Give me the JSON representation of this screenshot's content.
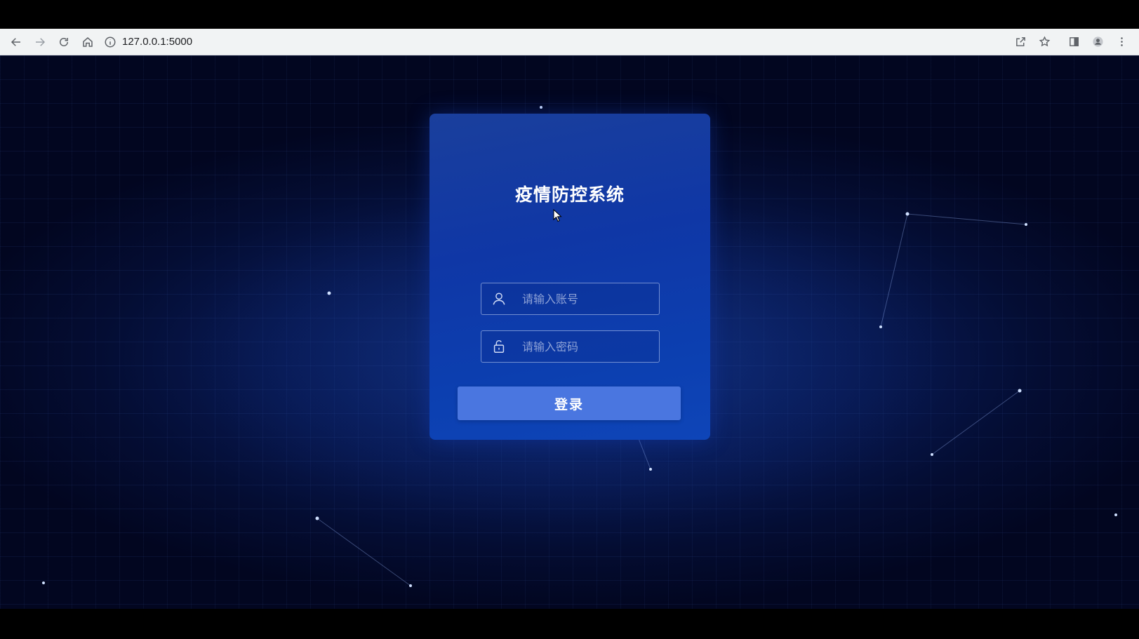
{
  "browser": {
    "url": "127.0.0.1:5000"
  },
  "login": {
    "title": "疫情防控系统",
    "account_placeholder": "请输入账号",
    "password_placeholder": "请输入密码",
    "submit_label": "登录"
  },
  "colors": {
    "background": "#040d33",
    "card": "#0f37a6",
    "button": "#4a76e0",
    "title_text": "#ffffff"
  },
  "icons": {
    "back": "arrow-left-icon",
    "forward": "arrow-right-icon",
    "reload": "reload-icon",
    "home": "home-icon",
    "info": "info-icon",
    "share": "share-icon",
    "bookmark": "star-icon",
    "sidepanel": "side-panel-icon",
    "profile": "profile-icon",
    "menu": "kebab-menu-icon",
    "user_field": "user-icon",
    "password_field": "lock-icon"
  }
}
